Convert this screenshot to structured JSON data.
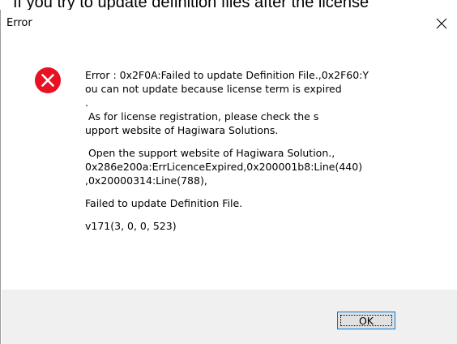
{
  "background": {
    "caption": "If you try to update definition files after the license"
  },
  "dialog": {
    "title": "Error",
    "close_icon": "close-x-icon",
    "error_icon": "error-red-circle-x-icon",
    "error_color": "#e81123",
    "message_lines": [
      "Error : 0x2F0A:Failed to update Definition File.,0x2F60:Y",
      "ou can not update because license term is expired",
      ".",
      " As for license registration, please check the s",
      "upport website of Hagiwara Solutions.",
      "",
      " Open the support website of Hagiwara Solution.,",
      "0x286e200a:ErrLicenceExpired,0x200001b8:Line(440)",
      ",0x20000314:Line(788),",
      "",
      "Failed to update Definition File.",
      "",
      "v171(3, 0, 0, 523)"
    ],
    "ok_label": "OK"
  }
}
